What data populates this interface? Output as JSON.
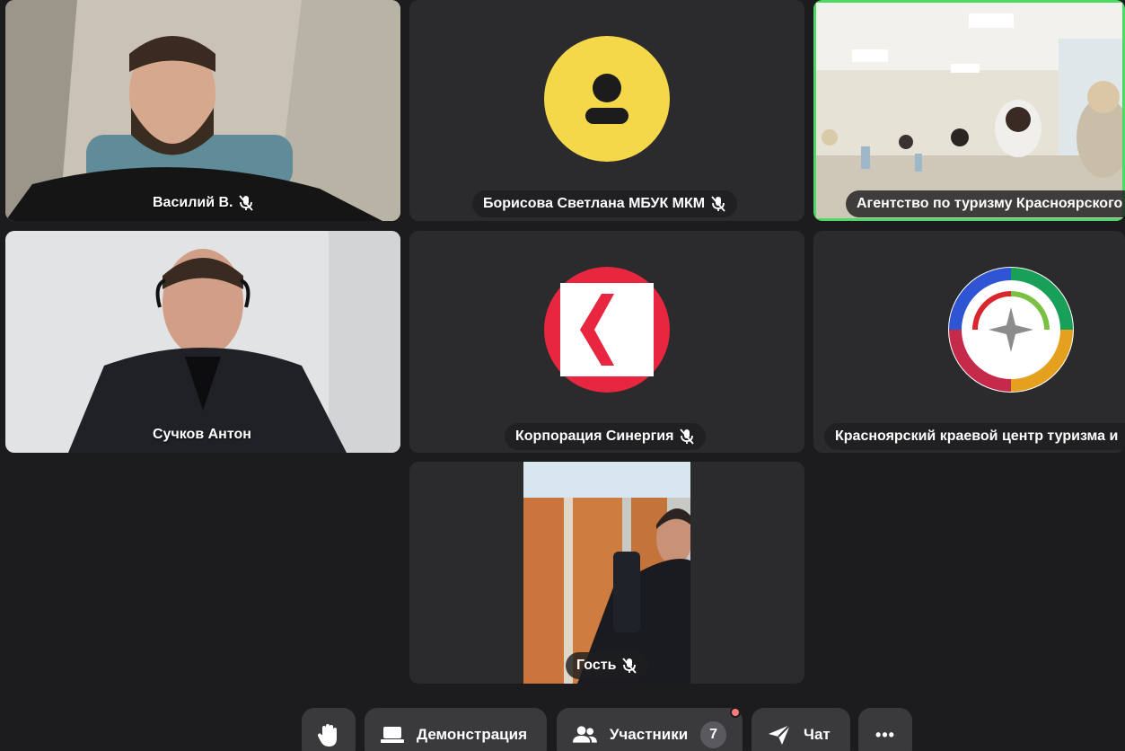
{
  "colors": {
    "background": "#1c1c1e",
    "tile": "#2b2b2e",
    "speaking_border": "#4cd964",
    "avatar_yellow": "#f5d84a",
    "synergy_red": "#e8263f",
    "notification": "#ff7b7b"
  },
  "participants": [
    {
      "name": "Василий В.",
      "muted": true,
      "type": "video",
      "icon": "mic-off-icon"
    },
    {
      "name": "Борисова Светлана МБУК МКМ",
      "muted": true,
      "type": "avatar",
      "icon": "mic-off-icon"
    },
    {
      "name": "Агентство по туризму Красноярского",
      "muted": false,
      "type": "video",
      "speaking": true
    },
    {
      "name": "Сучков Антон",
      "muted": false,
      "type": "video"
    },
    {
      "name": "Корпорация Синергия",
      "muted": true,
      "type": "logo",
      "icon": "mic-off-icon"
    },
    {
      "name": "Красноярский краевой центр туризма и",
      "muted": false,
      "type": "logo"
    },
    {
      "name": "Гость",
      "muted": true,
      "type": "video",
      "icon": "mic-off-icon"
    }
  ],
  "toolbar": {
    "raise_hand_icon": "hand-icon",
    "demo_label": "Демонстрация",
    "demo_icon": "laptop-icon",
    "participants_label": "Участники",
    "participants_icon": "people-icon",
    "participants_count": "7",
    "chat_label": "Чат",
    "chat_icon": "send-icon",
    "more_label": "•••",
    "more_icon": "more-icon"
  }
}
